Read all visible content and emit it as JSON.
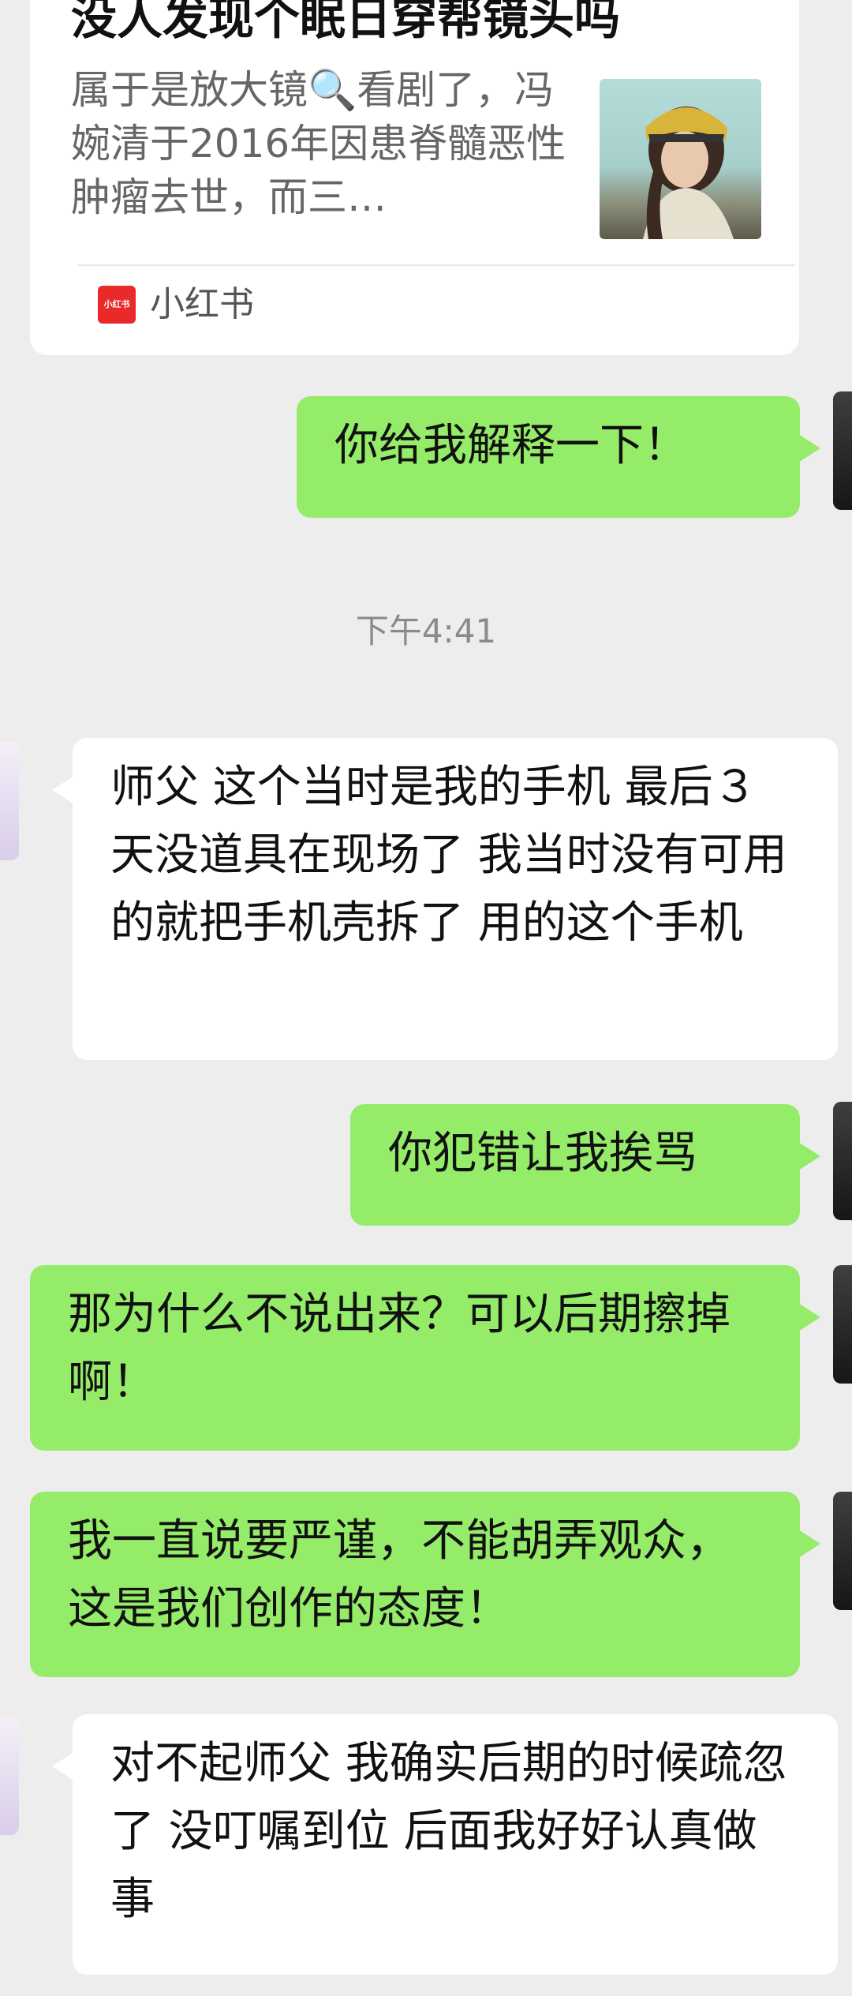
{
  "card": {
    "title": "没人发现个眠日穿帮镜头吗",
    "description": "属于是放大镜🔍看剧了，冯婉清于2016年因患脊髓恶性肿瘤去世，而三…",
    "source": "小红书",
    "source_logo_text": "小红书"
  },
  "timestamp": "下午4:41",
  "messages": [
    {
      "side": "right",
      "text": "你给我解释一下！"
    },
    {
      "side": "left",
      "text": "师父 这个当时是我的手机 最后３天没道具在现场了 我当时没有可用的就把手机壳拆了 用的这个手机"
    },
    {
      "side": "right",
      "text": "你犯错让我挨骂"
    },
    {
      "side": "right",
      "text": "那为什么不说出来？可以后期擦掉啊！"
    },
    {
      "side": "right",
      "text": "我一直说要严谨，不能胡弄观众，这是我们创作的态度！"
    },
    {
      "side": "left",
      "text": "对不起师父 我确实后期的时候疏忽了 没叮嘱到位 后面我好好认真做事"
    }
  ],
  "colors": {
    "background": "#ededed",
    "outgoing_bubble": "#95ec69",
    "incoming_bubble": "#ffffff",
    "source_logo": "#ea2a2a"
  }
}
